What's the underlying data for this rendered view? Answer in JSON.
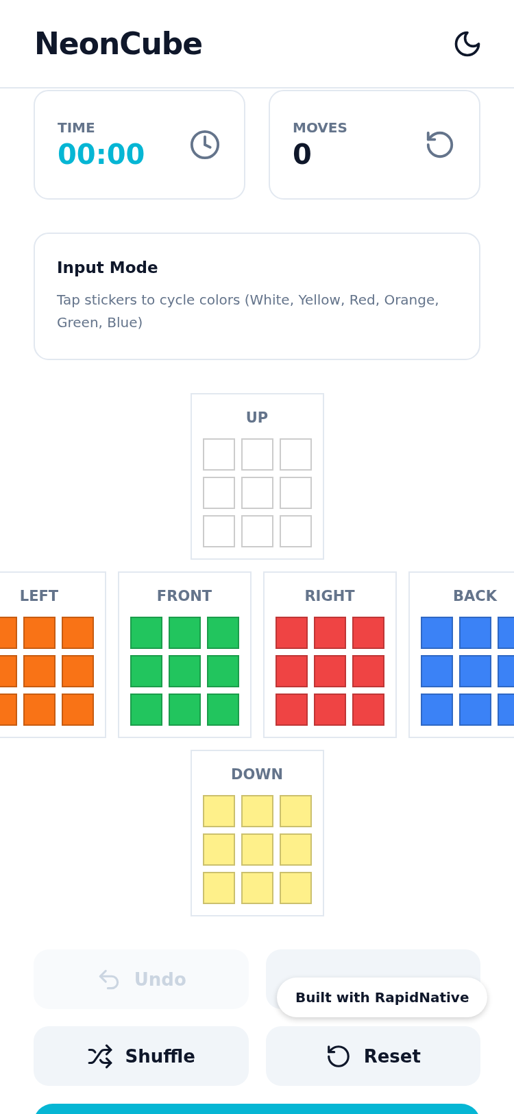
{
  "header": {
    "title": "NeonCube"
  },
  "stats": [
    {
      "kind": "time",
      "label": "TIME",
      "value": "00:00"
    },
    {
      "kind": "moves",
      "label": "MOVES",
      "value": "0"
    }
  ],
  "input_mode": {
    "title": "Input Mode",
    "description": "Tap stickers to cycle colors (White, Yellow, Red, Orange, Green, Blue)"
  },
  "net_rows": [
    {
      "faces": [
        {
          "label": "UP",
          "stickers": [
            {
              "color": "#ffffff"
            },
            {
              "color": "#ffffff"
            },
            {
              "color": "#ffffff"
            },
            {
              "color": "#ffffff"
            },
            {
              "color": "#ffffff"
            },
            {
              "color": "#ffffff"
            },
            {
              "color": "#ffffff"
            },
            {
              "color": "#ffffff"
            },
            {
              "color": "#ffffff"
            }
          ]
        }
      ]
    },
    {
      "faces": [
        {
          "label": "LEFT",
          "stickers": [
            {
              "color": "#f97316"
            },
            {
              "color": "#f97316"
            },
            {
              "color": "#f97316"
            },
            {
              "color": "#f97316"
            },
            {
              "color": "#f97316"
            },
            {
              "color": "#f97316"
            },
            {
              "color": "#f97316"
            },
            {
              "color": "#f97316"
            },
            {
              "color": "#f97316"
            }
          ]
        },
        {
          "label": "FRONT",
          "stickers": [
            {
              "color": "#22c55e"
            },
            {
              "color": "#22c55e"
            },
            {
              "color": "#22c55e"
            },
            {
              "color": "#22c55e"
            },
            {
              "color": "#22c55e"
            },
            {
              "color": "#22c55e"
            },
            {
              "color": "#22c55e"
            },
            {
              "color": "#22c55e"
            },
            {
              "color": "#22c55e"
            }
          ]
        },
        {
          "label": "RIGHT",
          "stickers": [
            {
              "color": "#ef4444"
            },
            {
              "color": "#ef4444"
            },
            {
              "color": "#ef4444"
            },
            {
              "color": "#ef4444"
            },
            {
              "color": "#ef4444"
            },
            {
              "color": "#ef4444"
            },
            {
              "color": "#ef4444"
            },
            {
              "color": "#ef4444"
            },
            {
              "color": "#ef4444"
            }
          ]
        },
        {
          "label": "BACK",
          "stickers": [
            {
              "color": "#3b82f6"
            },
            {
              "color": "#3b82f6"
            },
            {
              "color": "#3b82f6"
            },
            {
              "color": "#3b82f6"
            },
            {
              "color": "#3b82f6"
            },
            {
              "color": "#3b82f6"
            },
            {
              "color": "#3b82f6"
            },
            {
              "color": "#3b82f6"
            },
            {
              "color": "#3b82f6"
            }
          ]
        }
      ]
    },
    {
      "faces": [
        {
          "label": "DOWN",
          "stickers": [
            {
              "color": "#fef08a"
            },
            {
              "color": "#fef08a"
            },
            {
              "color": "#fef08a"
            },
            {
              "color": "#fef08a"
            },
            {
              "color": "#fef08a"
            },
            {
              "color": "#fef08a"
            },
            {
              "color": "#fef08a"
            },
            {
              "color": "#fef08a"
            },
            {
              "color": "#fef08a"
            }
          ]
        }
      ]
    }
  ],
  "buttons": [
    {
      "kind": "undo",
      "label": "Undo",
      "disabled": true
    },
    {
      "kind": "blank"
    },
    {
      "kind": "shuffle",
      "label": "Shuffle",
      "disabled": false
    },
    {
      "kind": "reset",
      "label": "Reset",
      "disabled": false
    }
  ],
  "badge": {
    "text": "Built with RapidNative"
  }
}
